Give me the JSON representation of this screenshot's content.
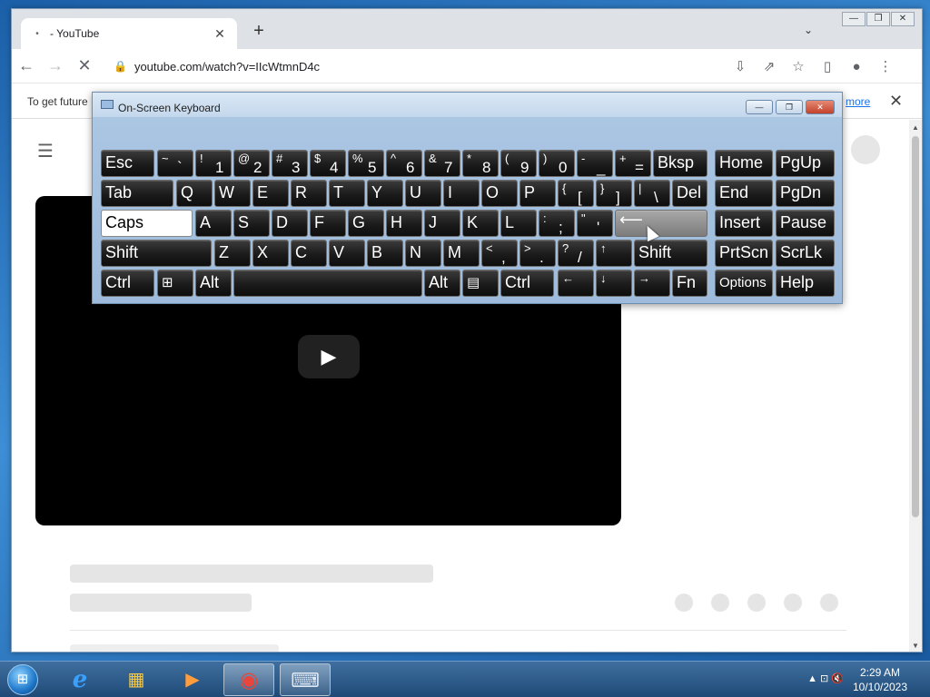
{
  "browser": {
    "tab_title": "- YouTube",
    "tab_spinner": "•",
    "tab_close": "✕",
    "new_tab": "+",
    "tab_search": "⌄",
    "window_controls": [
      "—",
      "❐",
      "✕"
    ],
    "back": "←",
    "forward": "→",
    "reload": "✕",
    "url": "youtube.com/watch?v=IIcWtmnD4c",
    "lock": "🔒",
    "install": "⇩",
    "share": "⇗",
    "star": "☆",
    "sidepanel": "▯",
    "profile": "●",
    "menu": "⋮"
  },
  "infobar": {
    "text": "To get future",
    "link": "more",
    "close": "✕"
  },
  "youtube": {
    "hamburger": "☰",
    "play": "▶"
  },
  "osk": {
    "title": "On-Screen Keyboard",
    "buttons": [
      "—",
      "❐",
      "✕"
    ],
    "keys": {
      "esc": "Esc",
      "tilde_sh": "~",
      "tilde": "`",
      "k1_sh": "!",
      "k1": "1",
      "k2_sh": "@",
      "k2": "2",
      "k3_sh": "#",
      "k3": "3",
      "k4_sh": "$",
      "k4": "4",
      "k5_sh": "%",
      "k5": "5",
      "k6_sh": "^",
      "k6": "6",
      "k7_sh": "&",
      "k7": "7",
      "k8_sh": "*",
      "k8": "8",
      "k9_sh": "(",
      "k9": "9",
      "k0_sh": ")",
      "k0": "0",
      "minus_sh": "-",
      "minus": "_",
      "plus_sh": "+",
      "plus": "=",
      "bksp": "Bksp",
      "home": "Home",
      "pgup": "PgUp",
      "tab": "Tab",
      "q": "Q",
      "w": "W",
      "e": "E",
      "r": "R",
      "t": "T",
      "y": "Y",
      "u": "U",
      "i": "I",
      "o": "O",
      "p": "P",
      "lbr_sh": "{",
      "lbr": "[",
      "rbr_sh": "}",
      "rbr": "]",
      "pipe_sh": "|",
      "pipe": "\\",
      "del": "Del",
      "end": "End",
      "pgdn": "PgDn",
      "caps": "Caps",
      "a": "A",
      "s": "S",
      "d": "D",
      "f": "F",
      "g": "G",
      "h": "H",
      "j": "J",
      "k": "K",
      "l": "L",
      "semi_sh": ":",
      "semi": ";",
      "quote_sh": "\"",
      "quote": "'",
      "enter": "⟵",
      "insert": "Insert",
      "pause": "Pause",
      "shift": "Shift",
      "z": "Z",
      "x": "X",
      "c": "C",
      "v": "V",
      "b": "B",
      "n": "N",
      "m": "M",
      "comma_sh": "<",
      "comma": ",",
      "period_sh": ">",
      "period": ".",
      "slash_sh": "?",
      "slash": "/",
      "up": "↑",
      "shift_r": "Shift",
      "prtscn": "PrtScn",
      "scrlk": "ScrLk",
      "ctrl": "Ctrl",
      "win": "⊞",
      "alt": "Alt",
      "alt_r": "Alt",
      "menu": "▤",
      "ctrl_r": "Ctrl",
      "left": "←",
      "down": "↓",
      "right": "→",
      "fn": "Fn",
      "options": "Options",
      "help": "Help"
    }
  },
  "taskbar": {
    "start": "⊞",
    "ie": "e",
    "explorer": "▦",
    "media": "▶",
    "chrome": "◉",
    "osk": "⌨",
    "tray_icons": "▲  ⊡  🔇",
    "time": "2:29 AM",
    "date": "10/10/2023"
  }
}
